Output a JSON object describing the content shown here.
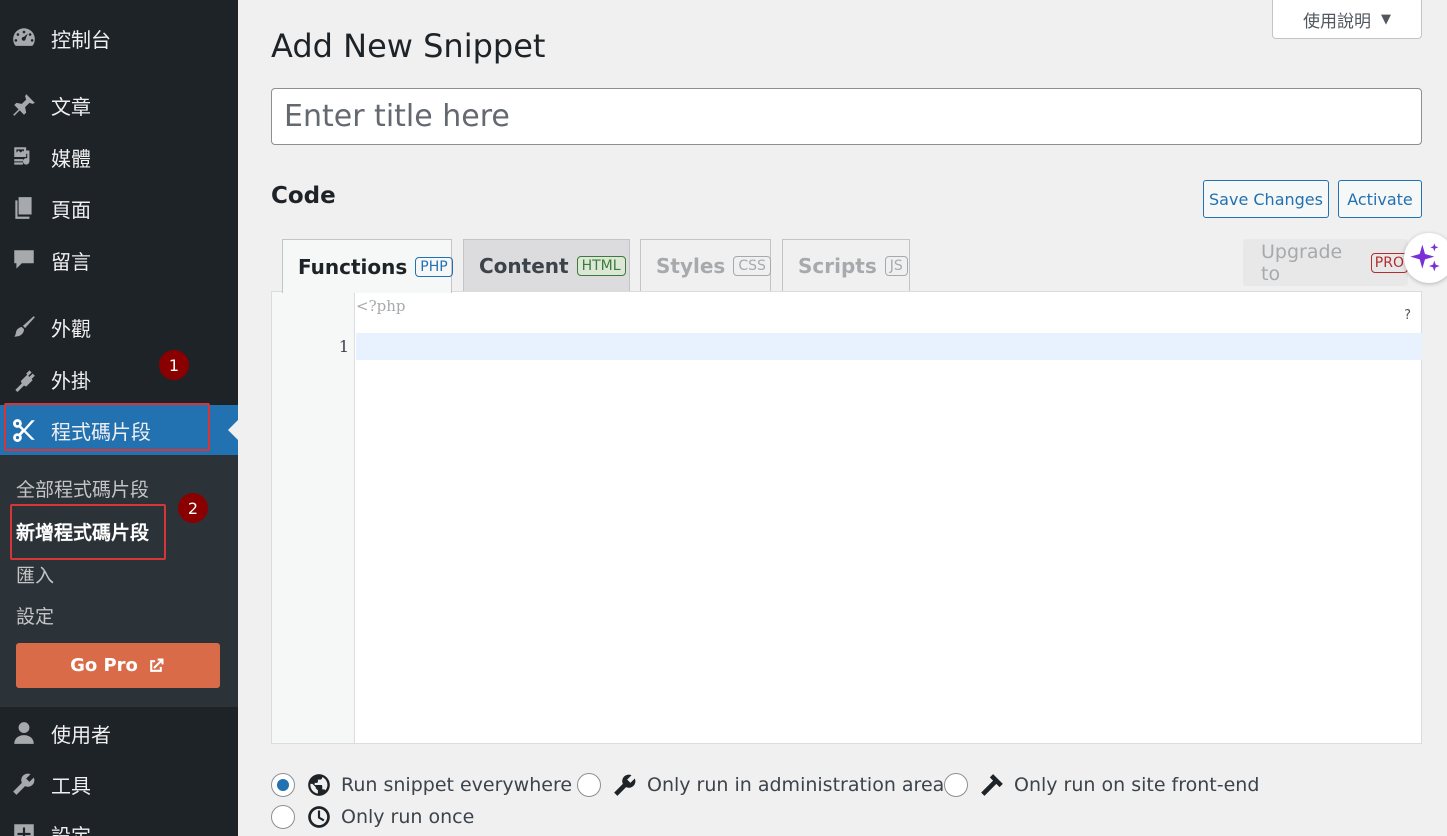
{
  "sidebar": {
    "items": [
      {
        "label": "控制台",
        "icon": "dashboard-icon"
      },
      {
        "label": "文章",
        "icon": "pin-icon"
      },
      {
        "label": "媒體",
        "icon": "media-icon"
      },
      {
        "label": "頁面",
        "icon": "pages-icon"
      },
      {
        "label": "留言",
        "icon": "comments-icon"
      },
      {
        "label": "外觀",
        "icon": "appearance-icon"
      },
      {
        "label": "外掛",
        "icon": "plugin-icon"
      },
      {
        "label": "程式碼片段",
        "icon": "scissors-icon"
      },
      {
        "label": "使用者",
        "icon": "user-icon"
      },
      {
        "label": "工具",
        "icon": "wrench-icon"
      },
      {
        "label": "設定",
        "icon": "settings-icon"
      }
    ],
    "submenu": [
      "全部程式碼片段",
      "新增程式碼片段",
      "匯入",
      "設定"
    ],
    "gopro_label": "Go Pro"
  },
  "annotations": [
    "1",
    "2"
  ],
  "help_tab": {
    "label": "使用說明",
    "arrow": "▼"
  },
  "main": {
    "title": "Add New Snippet",
    "title_placeholder": "Enter title here",
    "code_heading": "Code",
    "save_label": "Save Changes",
    "activate_label": "Activate",
    "tabs": [
      {
        "label": "Functions",
        "tag": "PHP"
      },
      {
        "label": "Content",
        "tag": "HTML"
      },
      {
        "label": "Styles",
        "tag": "CSS"
      },
      {
        "label": "Scripts",
        "tag": "JS"
      }
    ],
    "upgrade_label": "Upgrade to",
    "upgrade_tag": "PRO",
    "editor": {
      "php_open": "<?php",
      "line_number": "1",
      "help": "?"
    },
    "scope": [
      {
        "label": "Run snippet everywhere",
        "icon": "globe-icon",
        "checked": true
      },
      {
        "label": "Only run in administration area",
        "icon": "wrench-icon",
        "checked": false
      },
      {
        "label": "Only run on site front-end",
        "icon": "hammer-icon",
        "checked": false
      },
      {
        "label": "Only run once",
        "icon": "clock-icon",
        "checked": false
      }
    ]
  },
  "colors": {
    "sidebar_bg": "#1d2327",
    "accent": "#2271b1",
    "gopro": "#d96b49",
    "annotation": "#d63638"
  }
}
